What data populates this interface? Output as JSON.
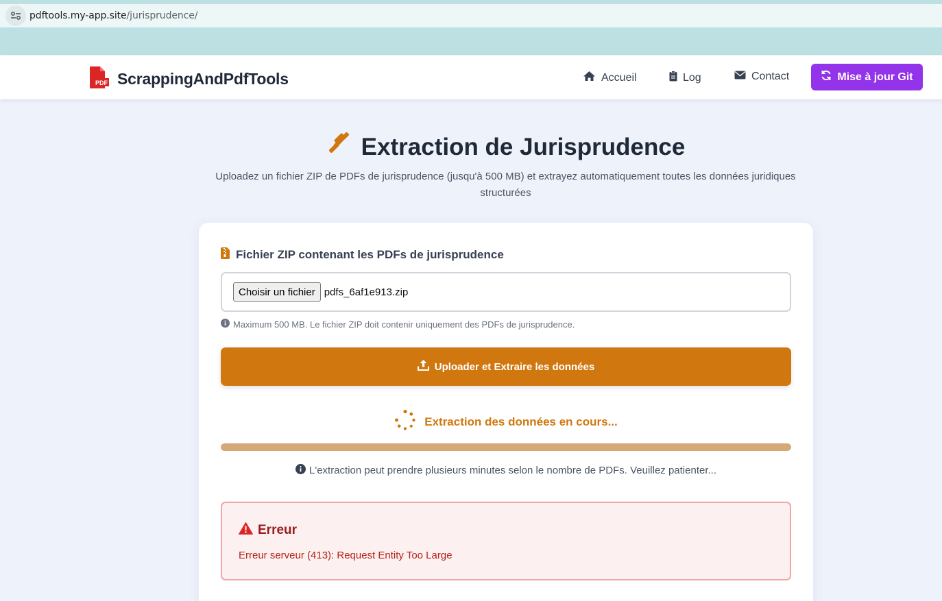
{
  "browser": {
    "url_host": "pdftools.my-app.site",
    "url_path": "/jurisprudence/"
  },
  "navbar": {
    "brand": "ScrappingAndPdfTools",
    "links": [
      {
        "label": "Accueil",
        "icon": "home-icon"
      },
      {
        "label": "Log",
        "icon": "clipboard-icon"
      },
      {
        "label": "Contact",
        "icon": "envelope-icon"
      }
    ],
    "git_button": "Mise à jour Git",
    "git_color": "#9333ea"
  },
  "hero": {
    "title": "Extraction de Jurisprudence",
    "subtitle": "Uploadez un fichier ZIP de PDFs de jurisprudence (jusqu'à 500 MB) et extrayez automatiquement toutes les données juridiques structurées"
  },
  "form": {
    "label": "Fichier ZIP contenant les PDFs de jurisprudence",
    "choose_button": "Choisir un fichier",
    "file_name": "pdfs_6af1e913.zip",
    "hint": "Maximum 500 MB. Le fichier ZIP doit contenir uniquement des PDFs de jurisprudence.",
    "upload_button": "Uploader et Extraire les données",
    "accent_color": "#d0780f"
  },
  "status": {
    "loading_text": "Extraction des données en cours...",
    "progress_percent": 100,
    "note": "L'extraction peut prendre plusieurs minutes selon le nombre de PDFs. Veuillez patienter..."
  },
  "error": {
    "title": "Erreur",
    "message": "Erreur serveur (413): Request Entity Too Large"
  }
}
